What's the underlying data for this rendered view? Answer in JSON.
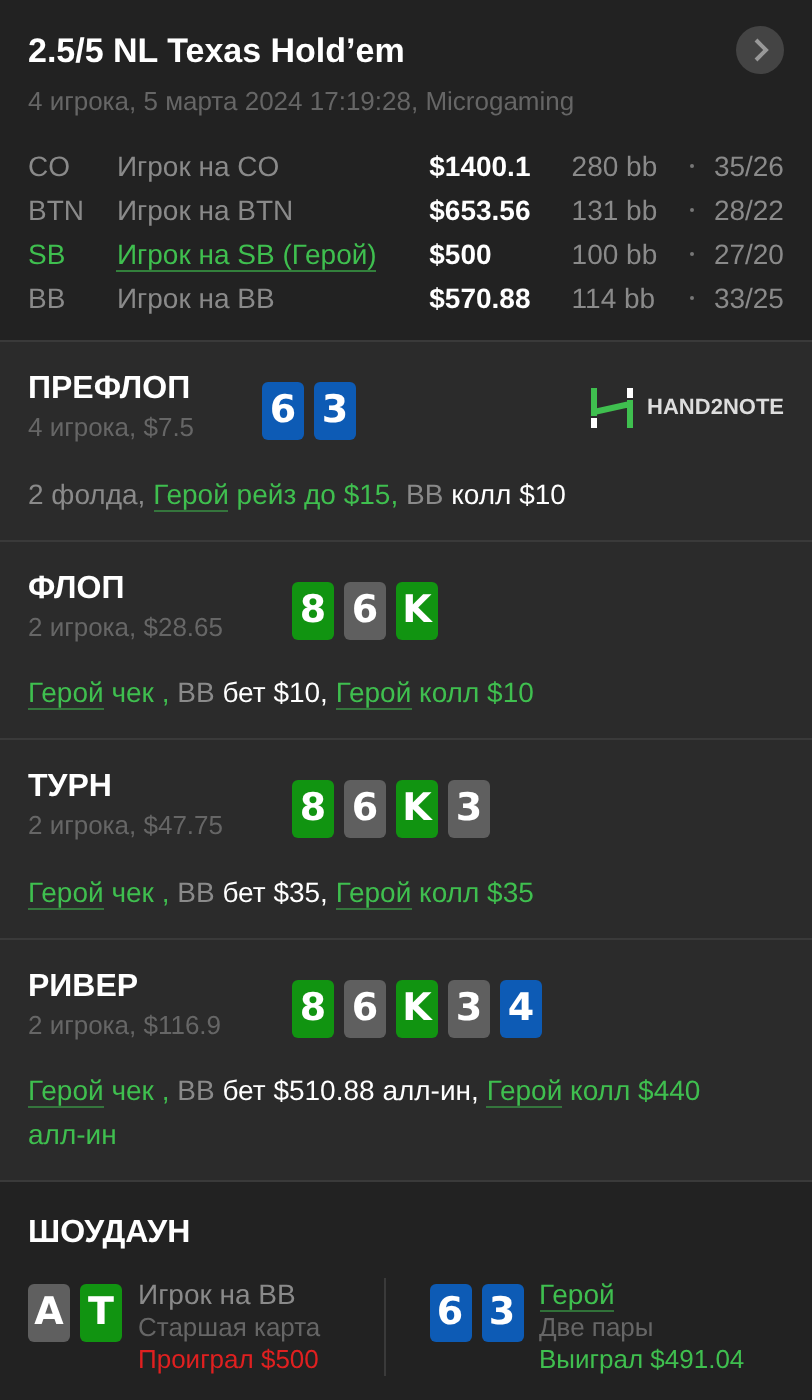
{
  "header": {
    "title": "2.5/5 NL Texas Hold’em",
    "subtitle": "4 игрока, 5 марта 2024 17:19:28, Microgaming"
  },
  "players": [
    {
      "position": "CO",
      "name": "Игрок на CO",
      "stack": "$1400.1",
      "bb": "280 bb",
      "stats": "35/26",
      "hero": false
    },
    {
      "position": "BTN",
      "name": "Игрок на BTN",
      "stack": "$653.56",
      "bb": "131 bb",
      "stats": "28/22",
      "hero": false
    },
    {
      "position": "SB",
      "name": "Игрок на SB (Герой)",
      "stack": "$500",
      "bb": "100 bb",
      "stats": "27/20",
      "hero": true
    },
    {
      "position": "BB",
      "name": "Игрок на BB",
      "stack": "$570.88",
      "bb": "114 bb",
      "stats": "33/25",
      "hero": false
    }
  ],
  "streets": [
    {
      "title": "ПРЕФЛОП",
      "info": "4 игрока, $7.5",
      "logo": "HAND2NOTE",
      "cards": [
        {
          "rank": "6",
          "color": "#0d5bb5"
        },
        {
          "rank": "3",
          "color": "#0d5bb5"
        }
      ],
      "actions": [
        {
          "kind": "plain",
          "text": "2 фолда, "
        },
        {
          "kind": "hero",
          "text": "Герой"
        },
        {
          "kind": "hero_action",
          "text": " рейз до $15, "
        },
        {
          "kind": "plain",
          "text": "BB"
        },
        {
          "kind": "action",
          "text": " колл $10"
        }
      ]
    },
    {
      "title": "ФЛОП",
      "info": "2 игрока, $28.65",
      "cards": [
        {
          "rank": "8",
          "color": "#119411"
        },
        {
          "rank": "6",
          "color": "#5f5f5f"
        },
        {
          "rank": "K",
          "color": "#119411"
        }
      ],
      "actions": [
        {
          "kind": "hero",
          "text": "Герой"
        },
        {
          "kind": "hero_action",
          "text": " чек , "
        },
        {
          "kind": "plain",
          "text": "BB"
        },
        {
          "kind": "action",
          "text": " бет $10, "
        },
        {
          "kind": "hero",
          "text": "Герой"
        },
        {
          "kind": "hero_action",
          "text": " колл $10"
        }
      ]
    },
    {
      "title": "ТУРН",
      "info": "2 игрока, $47.75",
      "cards": [
        {
          "rank": "8",
          "color": "#119411"
        },
        {
          "rank": "6",
          "color": "#5f5f5f"
        },
        {
          "rank": "K",
          "color": "#119411"
        },
        {
          "rank": "3",
          "color": "#5f5f5f"
        }
      ],
      "actions": [
        {
          "kind": "hero",
          "text": "Герой"
        },
        {
          "kind": "hero_action",
          "text": " чек , "
        },
        {
          "kind": "plain",
          "text": "BB"
        },
        {
          "kind": "action",
          "text": " бет $35, "
        },
        {
          "kind": "hero",
          "text": "Герой"
        },
        {
          "kind": "hero_action",
          "text": " колл $35"
        }
      ]
    },
    {
      "title": "РИВЕР",
      "info": "2 игрока, $116.9",
      "cards": [
        {
          "rank": "8",
          "color": "#119411"
        },
        {
          "rank": "6",
          "color": "#5f5f5f"
        },
        {
          "rank": "K",
          "color": "#119411"
        },
        {
          "rank": "3",
          "color": "#5f5f5f"
        },
        {
          "rank": "4",
          "color": "#0d5bb5"
        }
      ],
      "actions": [
        {
          "kind": "hero",
          "text": "Герой"
        },
        {
          "kind": "hero_action",
          "text": " чек , "
        },
        {
          "kind": "plain",
          "text": "BB"
        },
        {
          "kind": "action",
          "text": " бет $510.88 алл-ин, "
        },
        {
          "kind": "hero",
          "text": "Герой"
        },
        {
          "kind": "hero_action",
          "text": " колл $440 алл-ин"
        }
      ]
    }
  ],
  "showdown": {
    "title": "ШОУДАУН",
    "hands": [
      {
        "name": "Игрок на BB",
        "hero": false,
        "hand": "Старшая карта",
        "result": "Проиграл $500",
        "won": false,
        "cards": [
          {
            "rank": "A",
            "color": "#5f5f5f"
          },
          {
            "rank": "T",
            "color": "#119411"
          }
        ]
      },
      {
        "name": "Герой",
        "hero": true,
        "hand": "Две пары",
        "result": "Выиграл $491.04",
        "won": true,
        "cards": [
          {
            "rank": "6",
            "color": "#0d5bb5"
          },
          {
            "rank": "3",
            "color": "#0d5bb5"
          }
        ]
      }
    ]
  }
}
